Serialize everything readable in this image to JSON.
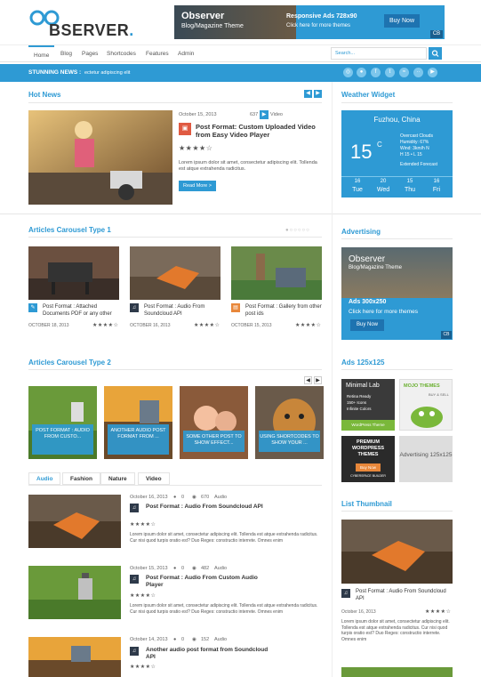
{
  "site": {
    "logo": "BSERVER",
    "logo_dot": "."
  },
  "topad": {
    "t1": "Observer",
    "t2": "Blog/Magazine Theme",
    "t3": "Responsive Ads 728x90",
    "t4": "Click here for more themes",
    "btn": "Buy Now",
    "cb": "CB"
  },
  "nav": {
    "items": [
      "Home",
      "Blog",
      "Pages",
      "Shortcodes",
      "Features",
      "Admin"
    ]
  },
  "search": {
    "placeholder": "Search..."
  },
  "ticker": {
    "label": "STUNNING NEWS :",
    "text": "ectetur adipiscing elit"
  },
  "hot": {
    "title": "Hot News",
    "date": "October 15, 2013",
    "views": "637",
    "format": "Video",
    "post_title": "Post Format: Custom Uploaded Video from Easy Video Player",
    "stars": "★★★★☆",
    "excerpt": "Lorem ipsum dolor sit amet, consectetur adipiscing elit. Tollenda est atque extrahenda radicitus.",
    "readmore": "Read More >"
  },
  "weather": {
    "title": "Weather Widget",
    "city": "Fuzhou, China",
    "temp": "15",
    "unit": "C",
    "cond": "Overcast Clouds",
    "humidity": "Humidity: 67%",
    "wind": "Wind: 3km/h N",
    "hl": "H 15 • L 15",
    "ext": "Extended Forecast",
    "days": [
      {
        "t": "16",
        "d": "Tue"
      },
      {
        "t": "20",
        "d": "Wed"
      },
      {
        "t": "15",
        "d": "Thu"
      },
      {
        "t": "16",
        "d": "Fri"
      }
    ]
  },
  "carousel1": {
    "title": "Articles Carousel Type 1",
    "items": [
      {
        "title": "Post Format : Attached Documents PDF or any other",
        "date": "OCTOBER 18, 2013"
      },
      {
        "title": "Post Format : Audio From Soundcloud API",
        "date": "OCTOBER 16, 2013"
      },
      {
        "title": "Post Format : Gallery from other post ids",
        "date": "OCTOBER 15, 2013"
      }
    ],
    "stars": "★★★★☆"
  },
  "advertising": {
    "title": "Advertising",
    "t1": "Observer",
    "t2": "Blog/Magazine Theme",
    "t3": "Ads 300x250",
    "t4": "Click here for more themes",
    "btn": "Buy Now",
    "cb": "CB"
  },
  "carousel2": {
    "title": "Articles Carousel Type 2",
    "items": [
      "POST FORMAT : AUDIO FROM CUSTO...",
      "ANOTHER AUDIO POST FORMAT FROM ...",
      "SOME OTHER POST TO SHOW EFFECT...",
      "USING SHORTCODES TO SHOW YOUR ..."
    ]
  },
  "ads125": {
    "title": "Ads 125x125",
    "a1": "Minimal Lab",
    "a1l": [
      "Retina Ready",
      "150+ Icons",
      "Infinite Colors"
    ],
    "a1f": "WordPress Theme",
    "a2": "MOJO THEMES",
    "a2b": "BUY & SELL",
    "a3": "PREMIUM WORDPRESS THEMES",
    "a3b": "Buy Now",
    "a3f": "CYBERSPACE BUILDER",
    "a4": "Advertising 125x125"
  },
  "tabs": [
    "Audio",
    "Fashion",
    "Nature",
    "Video"
  ],
  "list": [
    {
      "date": "October 16, 2013",
      "c": "0",
      "v": "670",
      "cat": "Audio",
      "title": "Post Format : Audio From Soundcloud API",
      "ex": "Lorem ipsum dolor sit amet, consectetur adipiscing elit. Tollenda est atque extrahenda radicitus. Cur nisi quod turpis oratio est? Duo Reges: constructio interrete. Omnes enim"
    },
    {
      "date": "October 15, 2013",
      "c": "0",
      "v": "482",
      "cat": "Audio",
      "title": "Post Format : Audio From Custom Audio Player",
      "ex": "Lorem ipsum dolor sit amet, consectetur adipiscing elit. Tollenda est atque extrahenda radicitus. Cur nisi quod turpis oratio est? Duo Reges: constructio interrete. Omnes enim"
    },
    {
      "date": "October 14, 2013",
      "c": "0",
      "v": "152",
      "cat": "Audio",
      "title": "Another audio post format from Soundcloud API",
      "ex": "Lorem ipsum dolor sit amet, consectetur adipiscing elit. Tollenda est atque extrahenda radicitus."
    }
  ],
  "listthumb": {
    "title": "List Thumbnail",
    "post_title": "Post Format : Audio From Soundcloud API",
    "date": "October 16, 2013",
    "ex": "Lorem ipsum dolor sit amet, consectetur adipiscing elit. Tollenda est atque extrahenda radicitus. Cur nisi quod turpis oratio est? Duo Reges: constructio interrete. Omnes enim"
  },
  "stars": "★★★★☆",
  "colors": {
    "accent": "#2e9ad4"
  }
}
